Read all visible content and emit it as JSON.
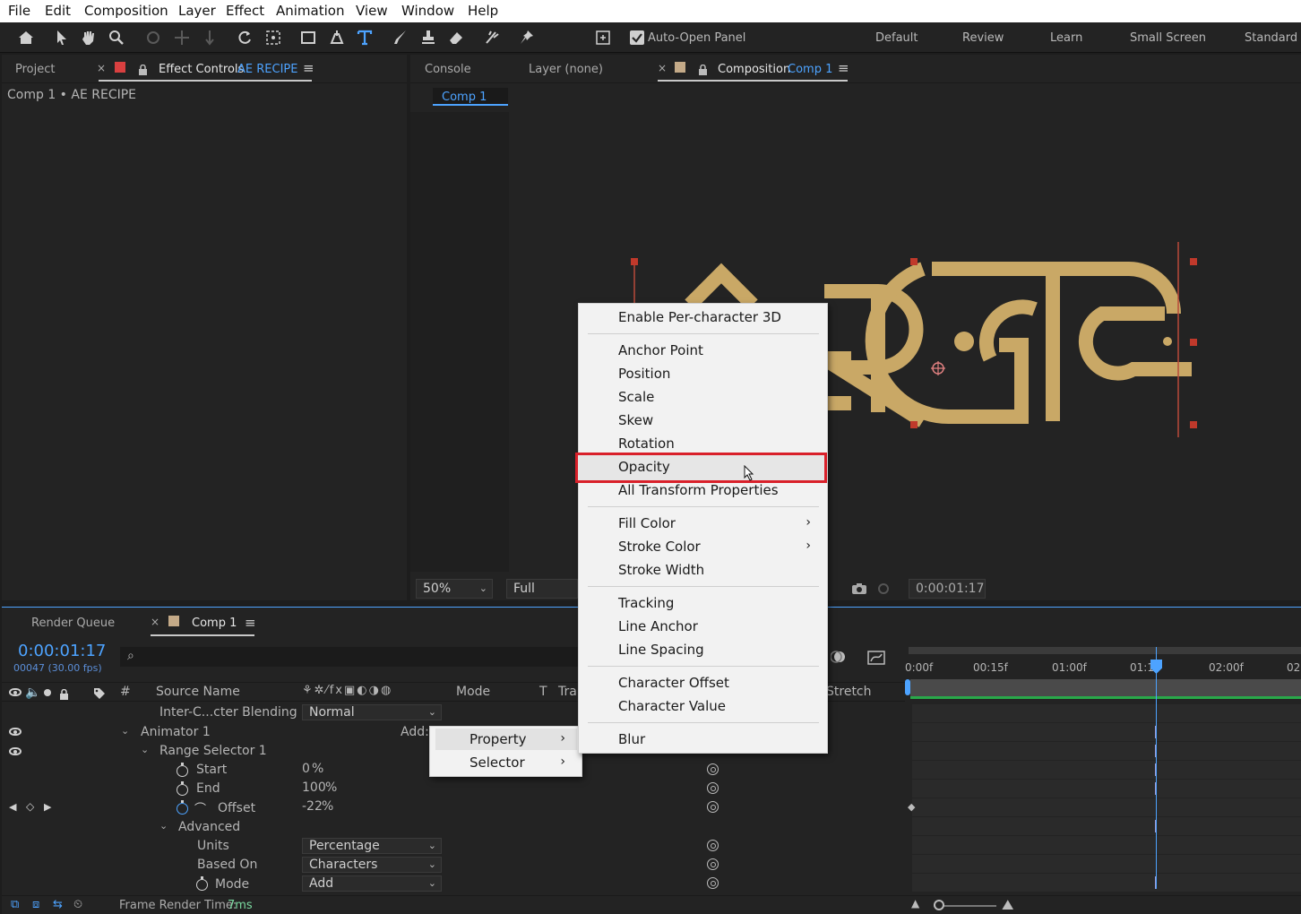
{
  "menu": [
    "File",
    "Edit",
    "Composition",
    "Layer",
    "Effect",
    "Animation",
    "View",
    "Window",
    "Help"
  ],
  "toolbar": {
    "auto_open_label": "Auto-Open Panel",
    "workspaces": [
      "Default",
      "Review",
      "Learn",
      "Small Screen",
      "Standard"
    ]
  },
  "left_panel": {
    "tab_project": "Project",
    "tab_effect_controls": "Effect Controls",
    "effect_layer": "AE RECIPE",
    "breadcrumb": "Comp 1 • AE RECIPE"
  },
  "viewer": {
    "tab_console": "Console",
    "tab_layer": "Layer (none)",
    "tab_composition": "Composition",
    "comp_name": "Comp 1",
    "comp_chip": "Comp 1",
    "zoom": "50%",
    "resolution": "Full",
    "timecode": "0:00:01:17"
  },
  "timeline": {
    "tab_render_queue": "Render Queue",
    "tab_comp": "Comp 1",
    "current_time": "0:00:01:17",
    "frame_info": "00047 (30.00 fps)",
    "col_hash": "#",
    "col_source_name": "Source Name",
    "col_mode": "Mode",
    "col_t": "T",
    "col_trk": "Tra",
    "col_stretch": "Stretch",
    "ruler": [
      "0:00f",
      "00:15f",
      "01:00f",
      "01:1",
      "02:00f",
      "02:"
    ],
    "rows": {
      "inter_char_label": "Inter-C...cter Blending",
      "inter_char_value": "Normal",
      "animator": "Animator 1",
      "add_label": "Add:",
      "range_selector": "Range Selector 1",
      "start_label": "Start",
      "start_value": "0",
      "start_unit": "%",
      "end_label": "End",
      "end_value": "100",
      "end_unit": "%",
      "offset_label": "Offset",
      "offset_value": "-22",
      "offset_unit": "%",
      "advanced_label": "Advanced",
      "units_label": "Units",
      "units_value": "Percentage",
      "based_on_label": "Based On",
      "based_on_value": "Characters",
      "mode_label": "Mode",
      "mode_value": "Add"
    },
    "frame_render_label": "Frame Render Time:",
    "frame_render_value": "7ms"
  },
  "context_menu": {
    "items": [
      "Enable Per-character 3D",
      "Anchor Point",
      "Position",
      "Scale",
      "Skew",
      "Rotation",
      "Opacity",
      "All Transform Properties",
      "Fill Color",
      "Stroke Color",
      "Stroke Width",
      "Tracking",
      "Line Anchor",
      "Line Spacing",
      "Character Offset",
      "Character Value",
      "Blur"
    ],
    "highlighted": "Opacity",
    "highlight_color": "#d9202a"
  },
  "submenu": {
    "items": [
      "Property",
      "Selector"
    ]
  },
  "colors": {
    "accent_blue": "#4da3ff",
    "artwork_gold": "#c9a866",
    "timecode_green": "#7bd9a0"
  }
}
